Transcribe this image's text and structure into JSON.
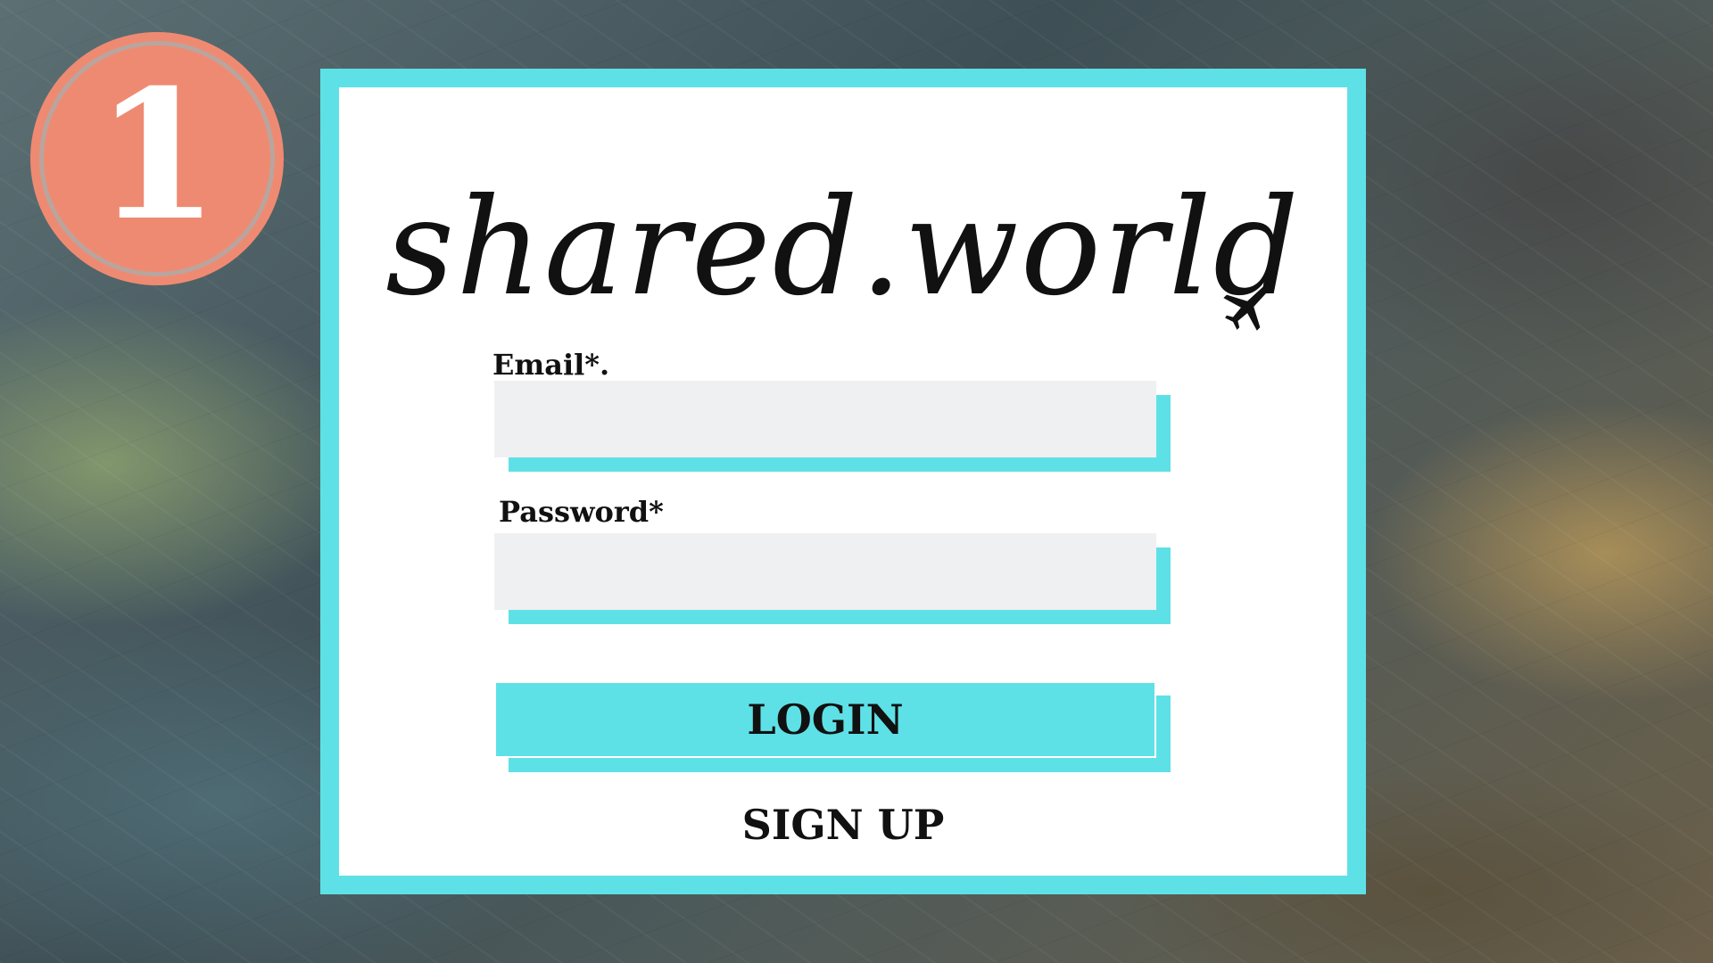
{
  "step_badge": {
    "number": "1",
    "color": "#ef8a72"
  },
  "app": {
    "logo_text": "shared.world",
    "logo_icon": "airplane-icon",
    "accent_color": "#5ee1e6"
  },
  "form": {
    "email_label": "Email*.",
    "email_value": "",
    "password_label": "Password*",
    "password_value": "",
    "login_label": "LOGIN",
    "signup_label": "SIGN UP"
  }
}
